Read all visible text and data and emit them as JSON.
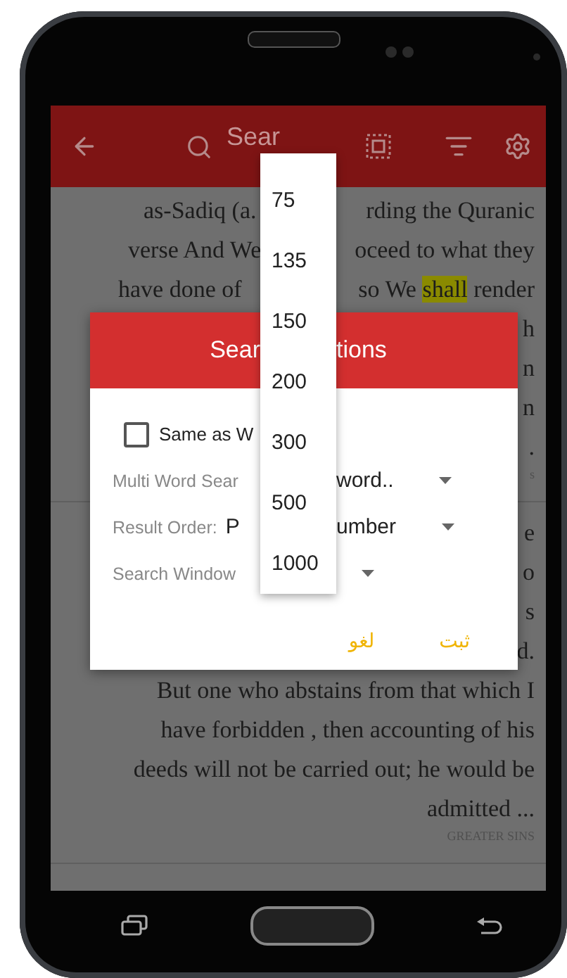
{
  "app_bar": {
    "search": {
      "placeholder": "Sear"
    }
  },
  "content": [
    {
      "kind": "line",
      "left": "as-Sadiq (a.",
      "right": [
        {
          "text": "rding the Quranic",
          "highlighted": false
        }
      ]
    },
    {
      "kind": "line",
      "left": "verse And We",
      "right": [
        {
          "text": "oceed to what they",
          "highlighted": false
        }
      ]
    },
    {
      "kind": "line",
      "left": "have done of",
      "right": [
        {
          "text": "so We ",
          "highlighted": false
        },
        {
          "text": "shall",
          "highlighted": true
        },
        {
          "text": " render",
          "highlighted": false
        }
      ]
    },
    {
      "kind": "line",
      "right": [
        {
          "text": "h",
          "highlighted": false
        }
      ]
    },
    {
      "kind": "line",
      "right": [
        {
          "text": "n",
          "highlighted": false
        }
      ]
    },
    {
      "kind": "line",
      "right": [
        {
          "text": "n",
          "highlighted": false
        }
      ]
    },
    {
      "kind": "line",
      "right": [
        {
          "text": ".",
          "highlighted": false
        }
      ]
    },
    {
      "kind": "caption",
      "text": "s"
    },
    {
      "kind": "divider"
    },
    {
      "kind": "line",
      "right": [
        {
          "text": "e",
          "highlighted": false
        }
      ]
    },
    {
      "kind": "line",
      "right": [
        {
          "text": "o",
          "highlighted": false
        }
      ]
    },
    {
      "kind": "line",
      "right": [
        {
          "text": "s",
          "highlighted": false
        }
      ]
    },
    {
      "kind": "line",
      "right": [
        {
          "text": "d.",
          "highlighted": false
        }
      ]
    },
    {
      "kind": "line",
      "right": [
        {
          "text": "But one who abstains from that which I",
          "highlighted": false
        }
      ]
    },
    {
      "kind": "line",
      "right": [
        {
          "text": "have forbidden , then accounting of his",
          "highlighted": false
        }
      ]
    },
    {
      "kind": "line",
      "right": [
        {
          "text": "deeds will not be carried out; he would be",
          "highlighted": false
        }
      ]
    },
    {
      "kind": "line",
      "right": [
        {
          "text": "admitted ...",
          "highlighted": false
        }
      ]
    },
    {
      "kind": "caption",
      "text": "GREATER SINS"
    },
    {
      "kind": "divider"
    }
  ],
  "dialog": {
    "title_parts": [
      "Sear",
      "tions"
    ],
    "checkbox": {
      "label": "Same as W",
      "checked": false
    },
    "fields": [
      {
        "label": "Multi Word Sear",
        "value": "word.."
      },
      {
        "label": "Result Order:",
        "value_start": "P",
        "value": "umber"
      },
      {
        "label": "Search Window"
      }
    ],
    "buttons": [
      "ثبت",
      "لغو"
    ]
  },
  "dropdown": {
    "options": [
      {
        "label": "75",
        "selected": false
      },
      {
        "label": "135",
        "selected": false
      },
      {
        "label": "150",
        "selected": false
      },
      {
        "label": "200",
        "selected": false
      },
      {
        "label": "300",
        "selected": false
      },
      {
        "label": "500",
        "selected": false
      },
      {
        "label": "1000",
        "selected": false
      }
    ]
  }
}
